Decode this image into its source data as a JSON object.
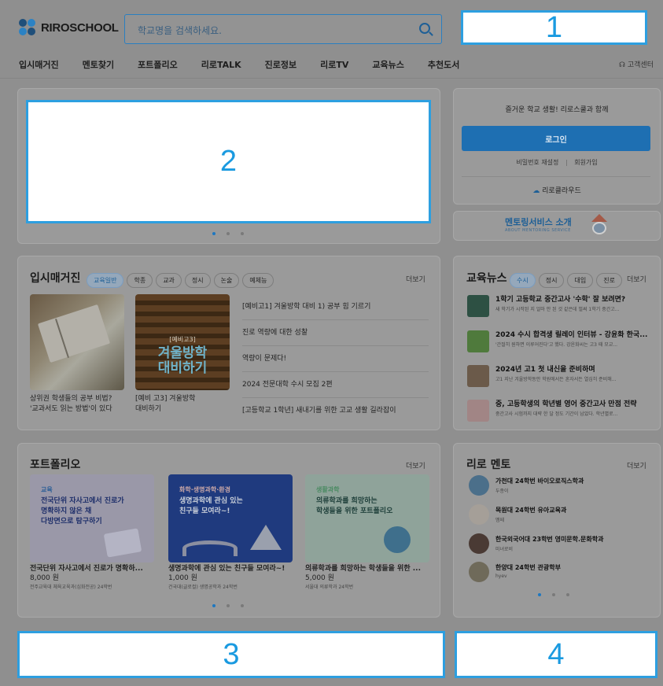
{
  "logo": {
    "text": "RIROSCHOOL"
  },
  "search": {
    "placeholder": "학교명을 검색하세요."
  },
  "nav": {
    "items": [
      "입시매거진",
      "멘토찾기",
      "포트폴리오",
      "리로TALK",
      "진로정보",
      "리로TV",
      "교육뉴스",
      "추천도서"
    ],
    "customer_center": "고객센터"
  },
  "overlays": {
    "box1": "1",
    "box2": "2",
    "box3": "3",
    "box4": "4"
  },
  "login": {
    "greeting": "즐거운 학교 생활! 리로스쿨과 함께",
    "button": "로그인",
    "reset": "비밀번호 재설정",
    "divider": "|",
    "signup": "회원가입",
    "cloud": "리로클라우드"
  },
  "mentoring_banner": {
    "title": "멘토링서비스 소개",
    "sub": "ABOUT MENTORING SERVICE"
  },
  "magazine": {
    "title": "입시매거진",
    "more": "더보기",
    "chips": [
      "교육일반",
      "학종",
      "교과",
      "정시",
      "논술",
      "예체능"
    ],
    "cards": [
      {
        "caption": "상위권 학생들의 공부 비법?\n'교과서도 읽는 방법'이 있다"
      },
      {
        "caption": "[예비 고3] 겨울방학\n대비하기",
        "thumb_tag": "[예비고3]",
        "thumb_title": "겨울방학\n대비하기"
      }
    ],
    "articles": [
      "[예비고1] 겨울방학 대비 1) 공부 힘 기르기",
      "진로 역량에 대한 성찰",
      "역량이 문제다!",
      "2024 전문대학 수시 모집 2편",
      "[고등학교 1학년] 새내기를 위한 고교 생활 길라잡이"
    ]
  },
  "edu_news": {
    "title": "교육뉴스",
    "more": "더보기",
    "chips": [
      "수시",
      "정시",
      "대입",
      "진로"
    ],
    "items": [
      {
        "title": "1학기 고등학교 중간고사 '수학' 잘 보려면?",
        "desc": "새 학기가 시작된 지 얼마 안 된 것 같은데 벌써 1학기 중간고..."
      },
      {
        "title": "2024 수시 합격생 릴레이 인터뷰 - 강윤화 한국...",
        "desc": "'간절히 원하면 이루어진다'고 했다. 강윤화씨는 고3 때 모교..."
      },
      {
        "title": "2024년 고1 첫 내신을 준비하며",
        "desc": "고1 지난 겨울방학동안 학원에서든 혼자서든 열심히 준비해..."
      },
      {
        "title": "중, 고등학생의 학년별 영어 중간고사 만점 전략",
        "desc": "중간고사 시험까지 대략 한 달 정도 기간이 남았다. 학년별로..."
      }
    ]
  },
  "portfolio": {
    "title": "포트폴리오",
    "more": "더보기",
    "cards": [
      {
        "tag": "교육",
        "thumb": "전국단위 자사고에서 진로가\n명확하지 않은 채\n다방면으로 탐구하기",
        "title": "전국단위 자사고에서 진로가 명확하...",
        "price": "8,000 원",
        "author": "전주교육대 체육교육과(심화전공) 24학번"
      },
      {
        "tag": "화학·생명과학·환경",
        "thumb": "생명과학에 관심 있는\n친구들 모여라~!",
        "title": "생명과학에 관심 있는 친구들 모여라~!",
        "price": "1,000 원",
        "author": "건국대(글로컬) 생명공학과 24학번"
      },
      {
        "tag": "생활과학",
        "thumb": "의류학과를 희망하는\n학생들을 위한 포트폴리오",
        "title": "의류학과를 희망하는 학생들을 위한 ...",
        "price": "5,000 원",
        "author": "서울대 의류학과 24학번"
      }
    ]
  },
  "riro_mentor": {
    "title": "리로 멘토",
    "more": "더보기",
    "mentors": [
      {
        "name": "가천대 24학번 바이오로직스학과",
        "id": "두종이"
      },
      {
        "name": "목원대 24학번 유아교육과",
        "id": "멤떼"
      },
      {
        "name": "한국외국어대 23학번 영미문학.문화학과",
        "id": "미녀로비"
      },
      {
        "name": "한양대 24학번 관광학부",
        "id": "hyev"
      }
    ]
  },
  "colors": {
    "accent": "#1e77c0",
    "overlay_border": "#2d9fe0",
    "overlay_text": "#1a9ae0"
  }
}
